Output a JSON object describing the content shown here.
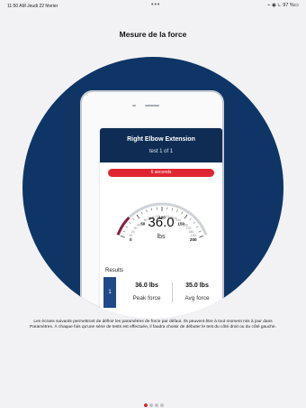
{
  "status_bar": {
    "time_date": "11:50 AM  Jeudi 22 février",
    "dots": "•••",
    "indicators": "⌁ ◉ ⏾ 97 %▭"
  },
  "page": {
    "title": "Mesure de la force",
    "description": "Les écrans suivants permettront de définir les paramètres de force par défaut. Ils peuvent être à tout moment mis à jour dans Paramètres. À chaque fois qu'une série de tests est effectuée, il faudra choisir de débuter le test du côté droit ou du côté gauche."
  },
  "test_card": {
    "name": "Right Elbow Extension",
    "count": "test 1 of 1",
    "timer": "6 seconds"
  },
  "gauge": {
    "value": "36.0",
    "unit": "lbs",
    "min": 0,
    "max": 200,
    "current": 36,
    "tick_labels": [
      "0",
      "10",
      "20",
      "30",
      "40",
      "50",
      "60",
      "70",
      "80",
      "90",
      "100",
      "110",
      "120",
      "130",
      "140",
      "150",
      "160",
      "170",
      "180",
      "190",
      "200"
    ],
    "colors": {
      "fill": "#8b1f3f",
      "track": "#cfd3d8",
      "tick": "#444444",
      "major_label": "#111111",
      "minor_label": "#8a8a8a"
    }
  },
  "results": {
    "label": "Results",
    "index": "1",
    "peak_value": "36.0 lbs",
    "peak_label": "Peak force",
    "avg_value": "35.0 lbs",
    "avg_label": "Avg force"
  },
  "pagination": {
    "count": 4,
    "active": 0
  },
  "colors": {
    "hero": "#0e3566",
    "header": "#0f2d54",
    "accent_red": "#e02532",
    "result_index": "#204b88"
  }
}
